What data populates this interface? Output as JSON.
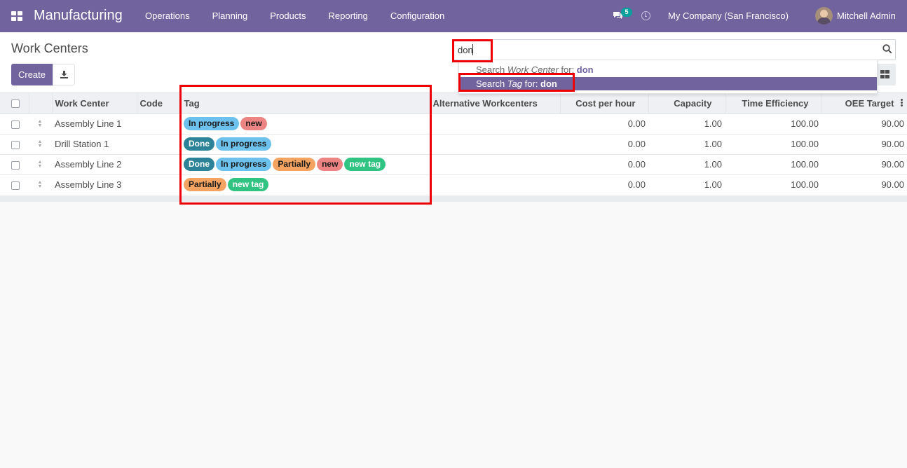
{
  "navbar": {
    "brand": "Manufacturing",
    "menu": [
      "Operations",
      "Planning",
      "Products",
      "Reporting",
      "Configuration"
    ],
    "messages_count": "5",
    "company": "My Company (San Francisco)",
    "user": "Mitchell Admin"
  },
  "control_panel": {
    "title": "Work Centers",
    "create_label": "Create",
    "search_value": "don",
    "autocomplete": [
      {
        "prefix": "Search ",
        "field": "Work Center",
        "mid": " for: ",
        "term": "don",
        "active": false
      },
      {
        "prefix": "Search ",
        "field": "Tag",
        "mid": " for: ",
        "term": "don",
        "active": true
      }
    ]
  },
  "table": {
    "columns": [
      "Work Center",
      "Code",
      "Tag",
      "Alternative Workcenters",
      "Cost per hour",
      "Capacity",
      "Time Efficiency",
      "OEE Target"
    ],
    "rows": [
      {
        "name": "Assembly Line 1",
        "code": "",
        "tags": [
          "In progress",
          "new"
        ],
        "alternatives": "",
        "cost": "0.00",
        "capacity": "1.00",
        "efficiency": "100.00",
        "oee": "90.00"
      },
      {
        "name": "Drill Station 1",
        "code": "",
        "tags": [
          "Done",
          "In progress"
        ],
        "alternatives": "",
        "cost": "0.00",
        "capacity": "1.00",
        "efficiency": "100.00",
        "oee": "90.00"
      },
      {
        "name": "Assembly Line 2",
        "code": "",
        "tags": [
          "Done",
          "In progress",
          "Partially",
          "new",
          "new tag"
        ],
        "alternatives": "",
        "cost": "0.00",
        "capacity": "1.00",
        "efficiency": "100.00",
        "oee": "90.00"
      },
      {
        "name": "Assembly Line 3",
        "code": "",
        "tags": [
          "Partially",
          "new tag"
        ],
        "alternatives": "",
        "cost": "0.00",
        "capacity": "1.00",
        "efficiency": "100.00",
        "oee": "90.00"
      }
    ]
  },
  "tag_colors": {
    "In progress": {
      "bg": "#6cc1ed",
      "fg": "#1a1a1a"
    },
    "new": {
      "bg": "#ed8484",
      "fg": "#1a1a1a"
    },
    "Done": {
      "bg": "#2c8397",
      "fg": "#ffffff"
    },
    "Partially": {
      "bg": "#f4a460",
      "fg": "#1a1a1a"
    },
    "new tag": {
      "bg": "#30c381",
      "fg": "#ffffff"
    }
  },
  "colors": {
    "brand": "#71639e",
    "badge": "#00a09d",
    "annotation": "#ee0000"
  },
  "icons": [
    "apps-icon",
    "chat-icon",
    "clock-icon",
    "download-icon",
    "search-icon",
    "kanban-icon",
    "optional-columns-icon",
    "drag-handle-icon"
  ]
}
